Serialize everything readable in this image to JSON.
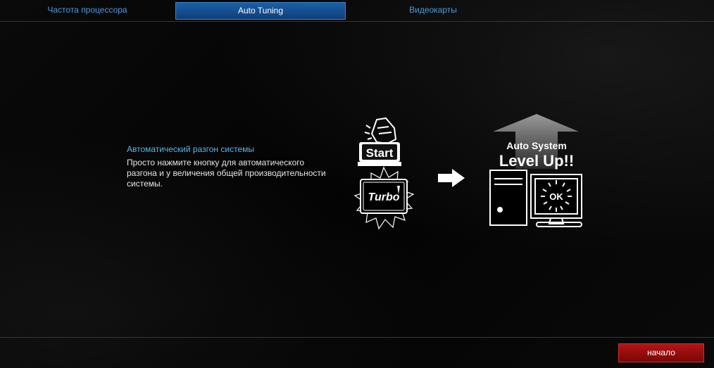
{
  "tabs": [
    {
      "label": "Частота процессора",
      "active": false
    },
    {
      "label": "Auto Tuning",
      "active": true
    },
    {
      "label": "Видеокарты",
      "active": false
    }
  ],
  "description": {
    "title": "Автоматический разгон системы",
    "body": "Просто нажмите кнопку для автоматического разгона и у величения общей производительности системы."
  },
  "illustration": {
    "start_label": "Start",
    "turbo_label": "Turbo",
    "auto_system_label": "Auto System",
    "level_up_label": "Level Up!!",
    "ok_label": "OK"
  },
  "footer": {
    "start_button_label": "начало"
  },
  "colors": {
    "accent": "#4b9be0",
    "active_tab": "#1b5fa8",
    "start_button": "#9b0e0e"
  }
}
